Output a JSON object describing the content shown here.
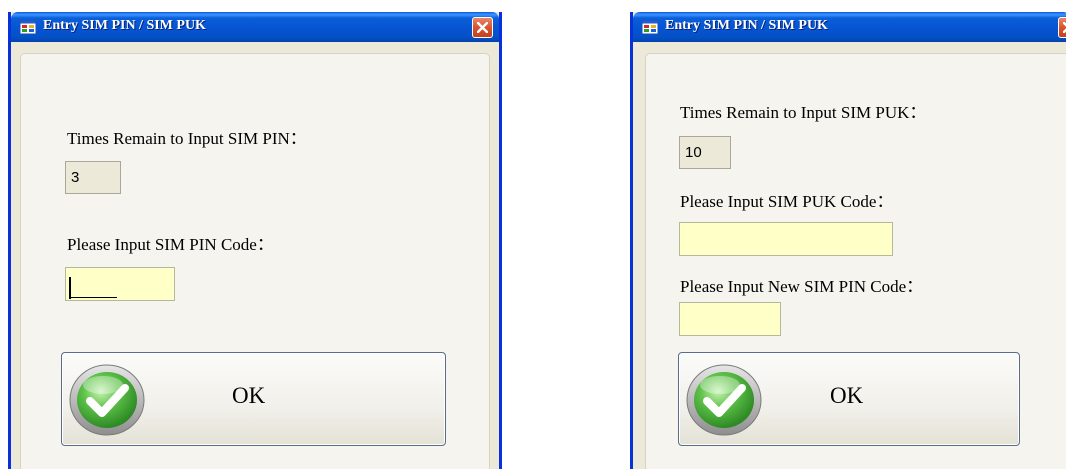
{
  "colors": {
    "titlebar": "#0654d2",
    "input_bg": "#ffffc8",
    "readonly_bg": "#ece9d8",
    "check_green": "#3aa62c"
  },
  "icons": [
    "app-icon",
    "close-icon",
    "check-icon"
  ],
  "pin_dialog": {
    "title": "Entry SIM PIN / SIM PUK",
    "times_label": "Times Remain to Input SIM PIN：",
    "times_value": "3",
    "pin_label": "Please Input SIM PIN Code：",
    "pin_value": "",
    "ok_label": "OK"
  },
  "puk_dialog": {
    "title": "Entry SIM PIN / SIM PUK",
    "times_label": "Times Remain to Input SIM PUK：",
    "times_value": "10",
    "puk_label": "Please Input SIM PUK Code：",
    "puk_value": "",
    "new_pin_label": "Please Input New SIM PIN Code：",
    "new_pin_value": "",
    "ok_label": "OK"
  }
}
